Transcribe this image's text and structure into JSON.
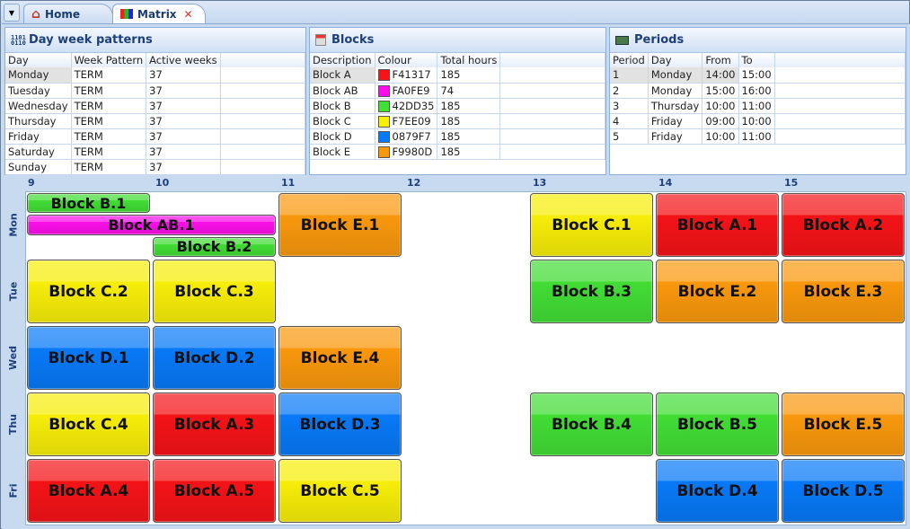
{
  "tabs": {
    "menu_label": "▼",
    "home": "Home",
    "matrix": "Matrix",
    "close": "✕"
  },
  "day_patterns": {
    "title": "Day week patterns",
    "columns": [
      "Day",
      "Week Pattern",
      "Active weeks"
    ],
    "rows": [
      [
        "Monday",
        "TERM",
        "37"
      ],
      [
        "Tuesday",
        "TERM",
        "37"
      ],
      [
        "Wednesday",
        "TERM",
        "37"
      ],
      [
        "Thursday",
        "TERM",
        "37"
      ],
      [
        "Friday",
        "TERM",
        "37"
      ],
      [
        "Saturday",
        "TERM",
        "37"
      ],
      [
        "Sunday",
        "TERM",
        "37"
      ]
    ]
  },
  "blocks": {
    "title": "Blocks",
    "columns": [
      "Description",
      "Colour",
      "Total hours"
    ],
    "rows": [
      [
        "Block A",
        "F41317",
        "185"
      ],
      [
        "Block AB",
        "FA0FE9",
        "74"
      ],
      [
        "Block B",
        "42DD35",
        "185"
      ],
      [
        "Block C",
        "F7EE09",
        "185"
      ],
      [
        "Block D",
        "0879F7",
        "185"
      ],
      [
        "Block E",
        "F9980D",
        "185"
      ]
    ]
  },
  "periods": {
    "title": "Periods",
    "columns": [
      "Period",
      "Day",
      "From",
      "To"
    ],
    "rows": [
      [
        "1",
        "Monday",
        "14:00",
        "15:00"
      ],
      [
        "2",
        "Monday",
        "15:00",
        "16:00"
      ],
      [
        "3",
        "Thursday",
        "10:00",
        "11:00"
      ],
      [
        "4",
        "Friday",
        "09:00",
        "10:00"
      ],
      [
        "5",
        "Friday",
        "10:00",
        "11:00"
      ]
    ]
  },
  "matrix": {
    "hours": [
      "9",
      "10",
      "11",
      "12",
      "13",
      "14",
      "15"
    ],
    "days": [
      "Mon",
      "Tue",
      "Wed",
      "Thu",
      "Fri"
    ],
    "entries": [
      {
        "label": "Block B.1",
        "day": "Mon",
        "start": 9,
        "end": 10,
        "color": "#42DD35"
      },
      {
        "label": "Block AB.1",
        "day": "Mon",
        "start": 9,
        "end": 11,
        "color": "#FA0FE9"
      },
      {
        "label": "Block B.2",
        "day": "Mon",
        "start": 10,
        "end": 11,
        "color": "#42DD35"
      },
      {
        "label": "Block E.1",
        "day": "Mon",
        "start": 11,
        "end": 12,
        "color": "#F9980D"
      },
      {
        "label": "Block C.1",
        "day": "Mon",
        "start": 13,
        "end": 14,
        "color": "#F7EE09"
      },
      {
        "label": "Block A.1",
        "day": "Mon",
        "start": 14,
        "end": 15,
        "color": "#F41317"
      },
      {
        "label": "Block A.2",
        "day": "Mon",
        "start": 15,
        "end": 16,
        "color": "#F41317"
      },
      {
        "label": "Block C.2",
        "day": "Tue",
        "start": 9,
        "end": 10,
        "color": "#F7EE09"
      },
      {
        "label": "Block C.3",
        "day": "Tue",
        "start": 10,
        "end": 11,
        "color": "#F7EE09"
      },
      {
        "label": "Block B.3",
        "day": "Tue",
        "start": 13,
        "end": 14,
        "color": "#42DD35"
      },
      {
        "label": "Block E.2",
        "day": "Tue",
        "start": 14,
        "end": 15,
        "color": "#F9980D"
      },
      {
        "label": "Block E.3",
        "day": "Tue",
        "start": 15,
        "end": 16,
        "color": "#F9980D"
      },
      {
        "label": "Block D.1",
        "day": "Wed",
        "start": 9,
        "end": 10,
        "color": "#0879F7"
      },
      {
        "label": "Block D.2",
        "day": "Wed",
        "start": 10,
        "end": 11,
        "color": "#0879F7"
      },
      {
        "label": "Block E.4",
        "day": "Wed",
        "start": 11,
        "end": 12,
        "color": "#F9980D"
      },
      {
        "label": "Block C.4",
        "day": "Thu",
        "start": 9,
        "end": 10,
        "color": "#F7EE09"
      },
      {
        "label": "Block A.3",
        "day": "Thu",
        "start": 10,
        "end": 11,
        "color": "#F41317"
      },
      {
        "label": "Block D.3",
        "day": "Thu",
        "start": 11,
        "end": 12,
        "color": "#0879F7"
      },
      {
        "label": "Block B.4",
        "day": "Thu",
        "start": 13,
        "end": 14,
        "color": "#42DD35"
      },
      {
        "label": "Block B.5",
        "day": "Thu",
        "start": 14,
        "end": 15,
        "color": "#42DD35"
      },
      {
        "label": "Block E.5",
        "day": "Thu",
        "start": 15,
        "end": 16,
        "color": "#F9980D"
      },
      {
        "label": "Block A.4",
        "day": "Fri",
        "start": 9,
        "end": 10,
        "color": "#F41317"
      },
      {
        "label": "Block A.5",
        "day": "Fri",
        "start": 10,
        "end": 11,
        "color": "#F41317"
      },
      {
        "label": "Block C.5",
        "day": "Fri",
        "start": 11,
        "end": 12,
        "color": "#F7EE09"
      },
      {
        "label": "Block D.4",
        "day": "Fri",
        "start": 14,
        "end": 15,
        "color": "#0879F7"
      },
      {
        "label": "Block D.5",
        "day": "Fri",
        "start": 15,
        "end": 16,
        "color": "#0879F7"
      }
    ]
  }
}
